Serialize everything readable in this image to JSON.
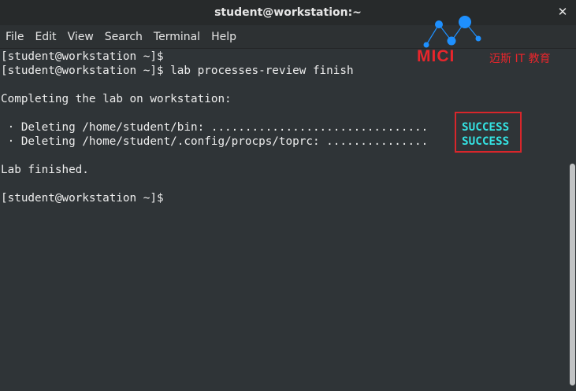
{
  "window": {
    "title": "student@workstation:~",
    "close_glyph": "✕"
  },
  "menu": {
    "items": [
      "File",
      "Edit",
      "View",
      "Search",
      "Terminal",
      "Help"
    ]
  },
  "terminal": {
    "lines": [
      "[student@workstation ~]$",
      "[student@workstation ~]$ lab processes-review finish",
      "",
      "Completing the lab on workstation:",
      "",
      " · Deleting /home/student/bin: ................................",
      " · Deleting /home/student/.config/procps/toprc: ...............",
      "",
      "Lab finished.",
      "",
      "[student@workstation ~]$"
    ],
    "status": [
      "SUCCESS",
      "SUCCESS"
    ],
    "status_color": "#34e2e2",
    "highlight_color": "#d8262b"
  },
  "watermark": {
    "brand": "MICI",
    "subtitle": "迈斯 IT 教育",
    "color": "#e8262c",
    "node_color": "#1e90ff"
  }
}
